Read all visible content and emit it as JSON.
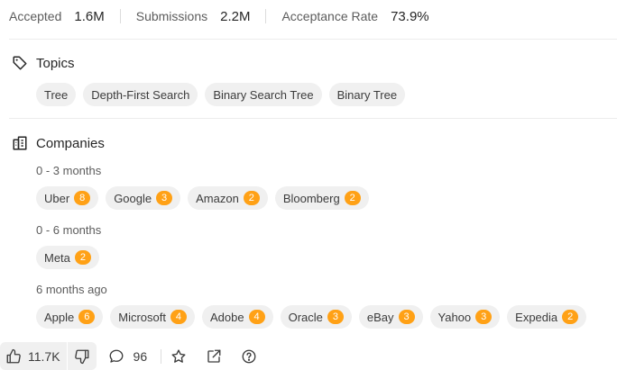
{
  "stats": [
    {
      "label": "Accepted",
      "value": "1.6M"
    },
    {
      "label": "Submissions",
      "value": "2.2M"
    },
    {
      "label": "Acceptance Rate",
      "value": "73.9%"
    }
  ],
  "topics": {
    "title": "Topics",
    "icon": "tag-icon",
    "tags": [
      "Tree",
      "Depth-First Search",
      "Binary Search Tree",
      "Binary Tree"
    ]
  },
  "companies": {
    "title": "Companies",
    "icon": "building-icon",
    "groups": [
      {
        "period": "0 - 3 months",
        "items": [
          {
            "name": "Uber",
            "count": "8"
          },
          {
            "name": "Google",
            "count": "3"
          },
          {
            "name": "Amazon",
            "count": "2"
          },
          {
            "name": "Bloomberg",
            "count": "2"
          }
        ]
      },
      {
        "period": "0 - 6 months",
        "items": [
          {
            "name": "Meta",
            "count": "2"
          }
        ]
      },
      {
        "period": "6 months ago",
        "items": [
          {
            "name": "Apple",
            "count": "6"
          },
          {
            "name": "Microsoft",
            "count": "4"
          },
          {
            "name": "Adobe",
            "count": "4"
          },
          {
            "name": "Oracle",
            "count": "3"
          },
          {
            "name": "eBay",
            "count": "3"
          },
          {
            "name": "Yahoo",
            "count": "3"
          },
          {
            "name": "Expedia",
            "count": "2"
          }
        ]
      }
    ]
  },
  "toolbar": {
    "likes": "11.7K",
    "comments": "96"
  },
  "colors": {
    "accent": "#ffa116",
    "chip_bg": "#f0f0f0",
    "text": "#262626",
    "muted": "#5c5c5c"
  }
}
